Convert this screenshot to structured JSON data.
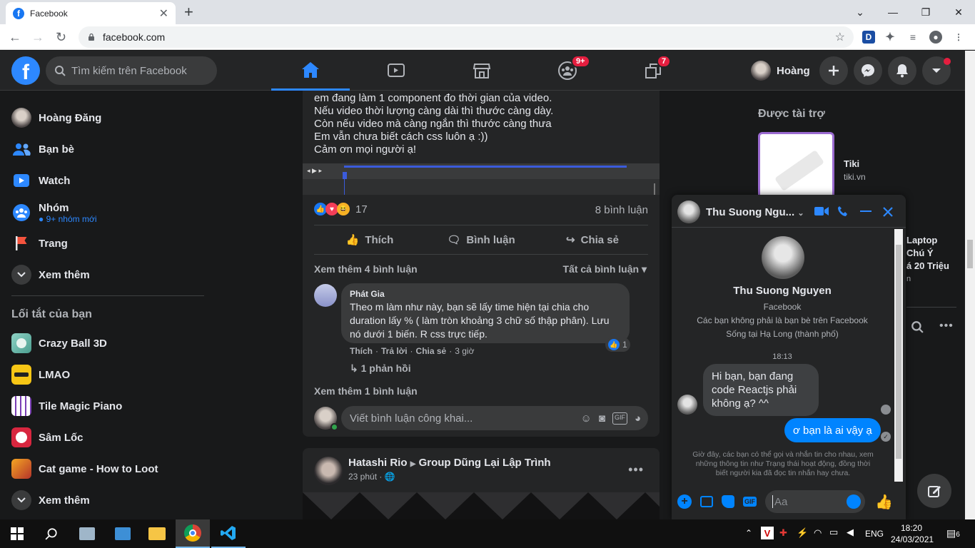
{
  "browser": {
    "tab_title": "Facebook",
    "url": "facebook.com",
    "ext_label": "D"
  },
  "header": {
    "logo": "f",
    "search_placeholder": "Tìm kiếm trên Facebook",
    "groups_badge": "9+",
    "gaming_badge": "7",
    "profile_name": "Hoàng",
    "accent": "#2d88ff"
  },
  "sidebar": {
    "items": [
      {
        "label": "Hoàng Đăng",
        "icon": "avatar"
      },
      {
        "label": "Bạn bè",
        "icon": "friends-icon"
      },
      {
        "label": "Watch",
        "icon": "watch-icon"
      },
      {
        "label": "Nhóm",
        "icon": "groups-icon",
        "sub": "9+ nhóm mới"
      },
      {
        "label": "Trang",
        "icon": "flag-icon"
      },
      {
        "label": "Xem thêm",
        "icon": "chevron-down-icon"
      }
    ],
    "shortcuts_title": "Lối tắt của bạn",
    "shortcuts": [
      {
        "label": "Crazy Ball 3D"
      },
      {
        "label": "LMAO"
      },
      {
        "label": "Tile Magic Piano"
      },
      {
        "label": "Sâm Lốc"
      },
      {
        "label": "Cat game - How to Loot"
      },
      {
        "label": "Xem thêm"
      }
    ]
  },
  "post": {
    "lines": [
      "em đang làm 1 component đo thời gian của video.",
      "Nếu video thời lượng càng dài thì thước càng dày.",
      "Còn nếu video mà càng ngắn thì thước càng thưa",
      "Em vẫn chưa biết cách css luôn ạ :))",
      "Cảm ơn mọi người ạ!"
    ],
    "reaction_count": "17",
    "comment_count": "8 bình luận",
    "like_label": "Thích",
    "comment_label": "Bình luận",
    "share_label": "Chia sẻ",
    "more_comments": "Xem thêm 4 bình luận",
    "all_comments": "Tất cả bình luận",
    "comment": {
      "author": "Phát Gia",
      "text": "Theo m làm như này, bạn sẽ lấy time hiện tại chia cho duration lấy % ( làm tròn khoảng 3 chữ số thập phân). Lưu nó dưới 1 biến. R css trực tiếp.",
      "like": "Thích",
      "reply": "Trả lời",
      "share": "Chia sẻ",
      "time": "3 giờ",
      "likes": "1",
      "replies": "1 phản hồi"
    },
    "more_one": "Xem thêm 1 bình luận",
    "write_placeholder": "Viết bình luận công khai...",
    "gif": "GIF"
  },
  "post2": {
    "author": "Hatashi Rio",
    "group": "Group Dũng Lại Lập Trình",
    "time": "23 phút"
  },
  "right": {
    "sponsored_title": "Được tài trợ",
    "ad_name": "Tiki",
    "ad_domain": "tiki.vn",
    "ad2_line1": "Laptop",
    "ad2_line2": "Chú Ý",
    "ad2_line3": "á 20 Triệu",
    "ad2_line4": "n"
  },
  "chat": {
    "name_short": "Thu Suong Ngu...",
    "name": "Thu Suong Nguyen",
    "platform": "Facebook",
    "info1": "Các bạn không phải là bạn bè trên Facebook",
    "info2": "Sống tại Hạ Long (thành phố)",
    "time": "18:13",
    "msg_in": "Hi bạn, bạn đang code Reactjs phải không ạ? ^^",
    "msg_out": "ơ bạn là ai vậy ạ",
    "notice": "Giờ đây, các bạn có thể gọi và nhắn tin cho nhau, xem những thông tin như Trạng thái hoạt động, đồng thời biết người kia đã đọc tin nhắn hay chưa.",
    "input_placeholder": "Aa",
    "gif": "GIF"
  },
  "taskbar": {
    "lang": "ENG",
    "time": "18:20",
    "date": "24/03/2021",
    "notif_count": "6"
  }
}
